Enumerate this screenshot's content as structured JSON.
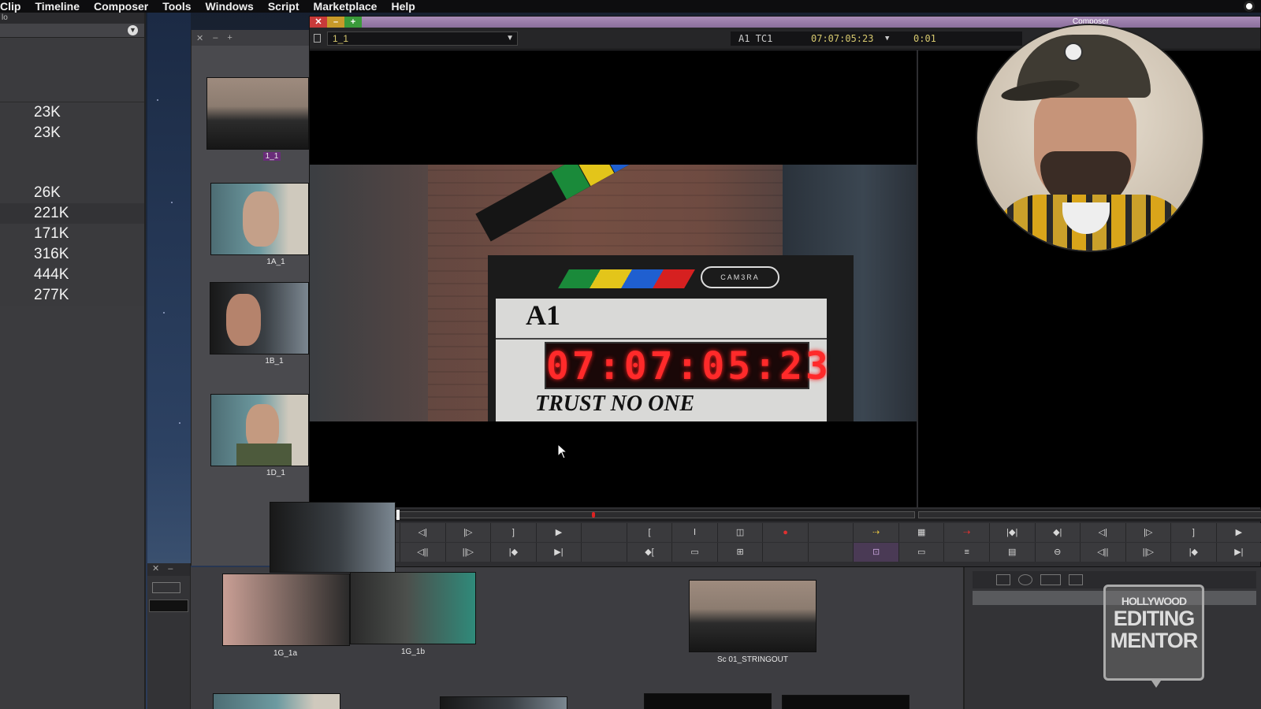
{
  "menu": [
    "Clip",
    "Timeline",
    "Composer",
    "Tools",
    "Windows",
    "Script",
    "Marketplace",
    "Help"
  ],
  "left_panel": {
    "header": "lo",
    "sizes": [
      "23K",
      "23K",
      "",
      "",
      "26K",
      "221K",
      "171K",
      "316K",
      "444K",
      "277K"
    ]
  },
  "thumb_bin": {
    "clips": [
      {
        "label": "1_1",
        "selected": true
      },
      {
        "label": "1A_1",
        "selected": false
      },
      {
        "label": "1B_1",
        "selected": false
      },
      {
        "label": "1D_1",
        "selected": false
      }
    ]
  },
  "composer": {
    "title": "Composer",
    "clip_name": "1_1",
    "track": "A1 TC1",
    "timecode": "07:07:05:23",
    "duration": "0:01"
  },
  "slate": {
    "roll": "A1",
    "led": "07:07:05:23",
    "text": "TRUST NO ONE",
    "logo": "CAM3RA"
  },
  "lower_bin": {
    "clips": [
      "1G_1a",
      "1G_1b",
      "Sc 01_STRINGOUT"
    ]
  },
  "watermark": {
    "line1": "HOLLYWOOD",
    "line2": "EDITING",
    "line3": "MENTOR"
  }
}
